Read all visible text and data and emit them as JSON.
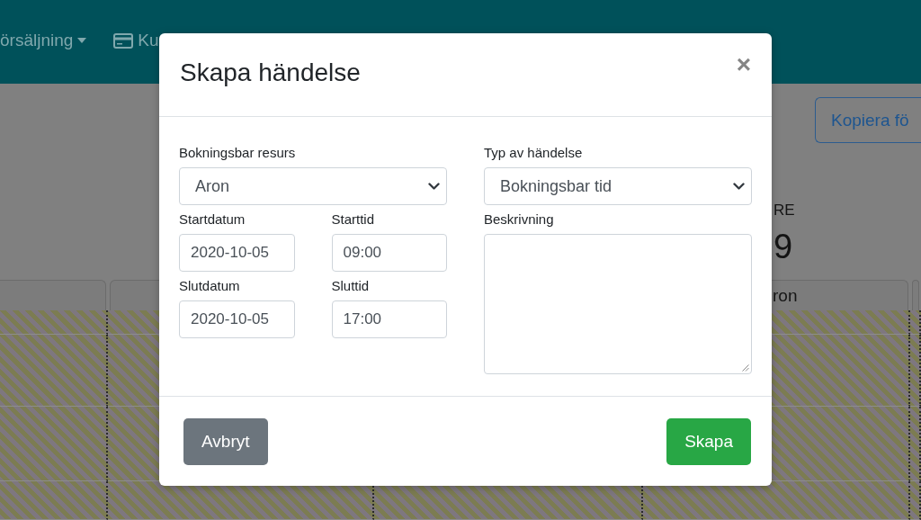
{
  "navbar": {
    "items": [
      {
        "kind": "dropdown",
        "label": "örsäljning"
      },
      {
        "kind": "iconlink",
        "label": "Ku"
      }
    ]
  },
  "toolbar": {
    "button": "Kopiera fö"
  },
  "stat": {
    "label": "RE",
    "value": "9"
  },
  "table": {
    "column_4": {
      "header": "ron"
    }
  },
  "dialog": {
    "title": "Skapa händelse",
    "close": "×",
    "columns": [
      {
        "fields": [
          {
            "kind": "select",
            "label": "Bokningsbar resurs",
            "value": "Aron"
          },
          {
            "kind": "input",
            "label": "Startdatum",
            "value": "2020-10-05"
          },
          {
            "kind": "input",
            "label": "Starttid",
            "value": "09:00"
          },
          {
            "kind": "input",
            "label": "Slutdatum",
            "value": "2020-10-05"
          },
          {
            "kind": "input",
            "label": "Sluttid",
            "value": "17:00"
          }
        ]
      },
      {
        "fields": [
          {
            "kind": "select",
            "label": "Typ av händelse",
            "value": "Bokningsbar tid"
          },
          {
            "kind": "textarea",
            "label": "Beskrivning"
          }
        ]
      }
    ],
    "buttons": [
      {
        "kind": "secondary",
        "label": "Avbryt"
      },
      {
        "kind": "success",
        "label": "Skapa"
      }
    ]
  }
}
